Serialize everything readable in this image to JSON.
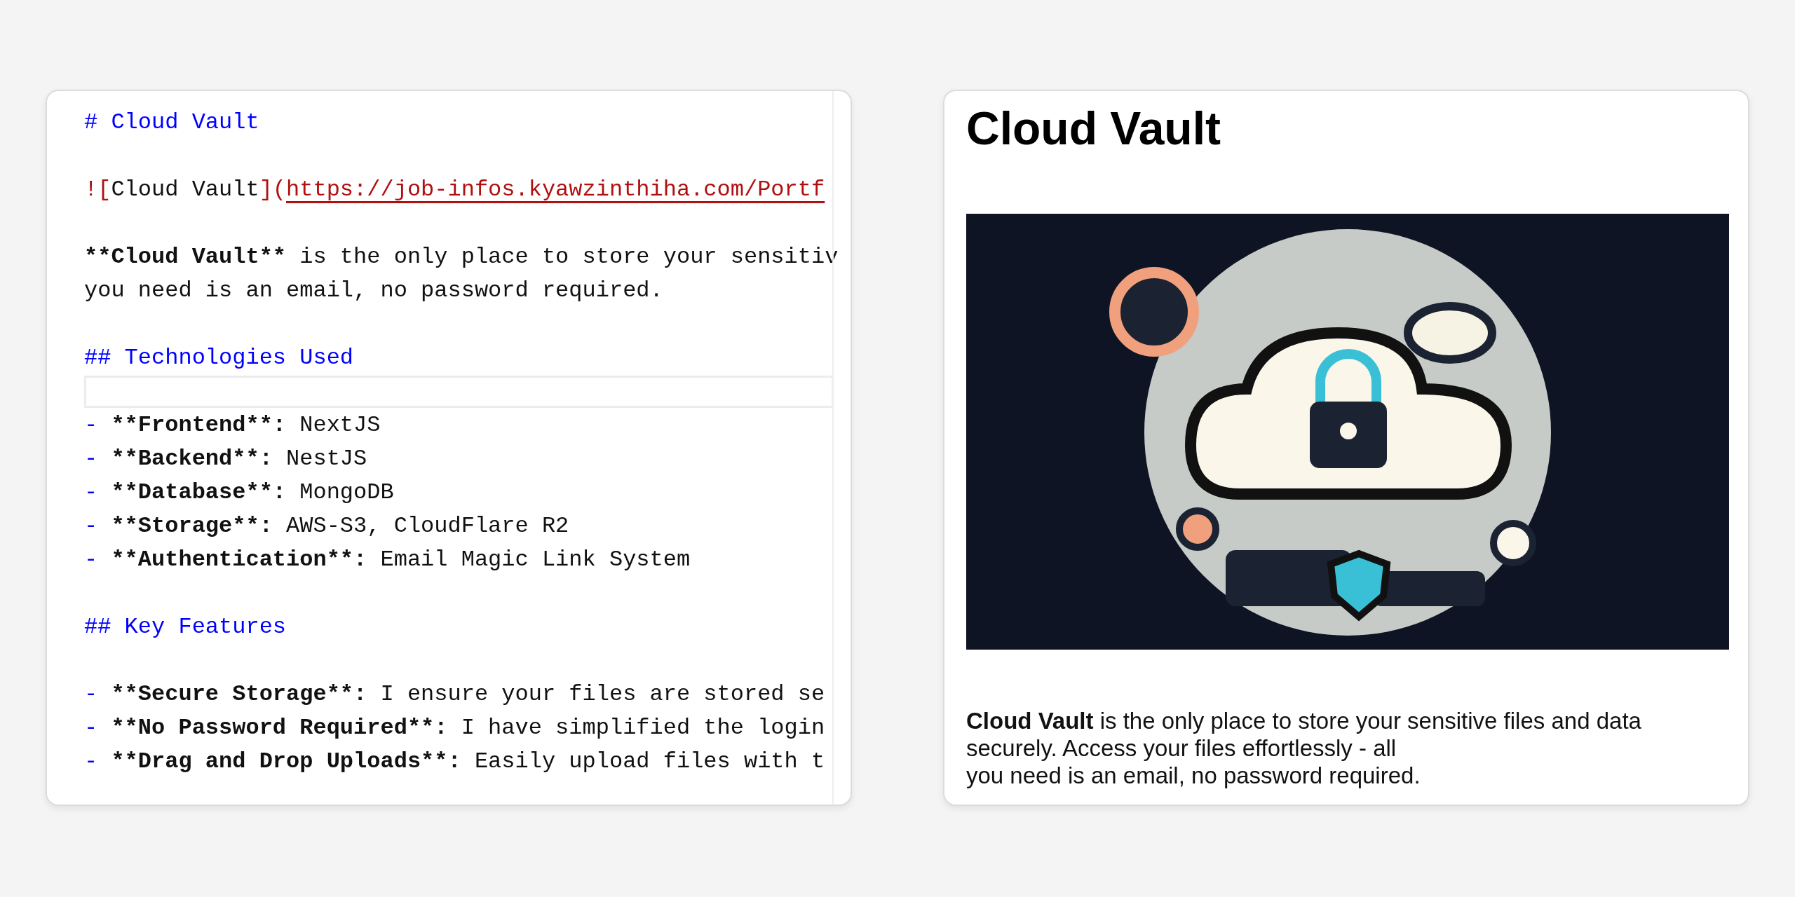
{
  "editor": {
    "lines": [
      {
        "kind": "heading",
        "parts": [
          {
            "kind": "heading",
            "text": "# Cloud Vault"
          }
        ]
      },
      {
        "kind": "blank"
      },
      {
        "kind": "text",
        "parts": [
          {
            "kind": "punct",
            "text": "!["
          },
          {
            "kind": "plain",
            "text": "Cloud Vault"
          },
          {
            "kind": "punct",
            "text": "]("
          },
          {
            "kind": "url",
            "text": "https://job-infos.kyawzinthiha.com/Portf"
          }
        ]
      },
      {
        "kind": "blank"
      },
      {
        "kind": "text",
        "parts": [
          {
            "kind": "bold",
            "text": "**Cloud Vault**"
          },
          {
            "kind": "plain",
            "text": " is the only place to store your sensitiv"
          }
        ]
      },
      {
        "kind": "text",
        "parts": [
          {
            "kind": "plain",
            "text": "you need is an email, no password required."
          }
        ]
      },
      {
        "kind": "blank"
      },
      {
        "kind": "heading",
        "parts": [
          {
            "kind": "heading",
            "text": "## Technologies Used"
          }
        ]
      },
      {
        "kind": "current"
      },
      {
        "kind": "text",
        "parts": [
          {
            "kind": "bullet",
            "text": "-"
          },
          {
            "kind": "bold",
            "text": " **Frontend**:"
          },
          {
            "kind": "plain",
            "text": " NextJS"
          }
        ]
      },
      {
        "kind": "text",
        "parts": [
          {
            "kind": "bullet",
            "text": "-"
          },
          {
            "kind": "bold",
            "text": " **Backend**:"
          },
          {
            "kind": "plain",
            "text": " NestJS"
          }
        ]
      },
      {
        "kind": "text",
        "parts": [
          {
            "kind": "bullet",
            "text": "-"
          },
          {
            "kind": "bold",
            "text": " **Database**:"
          },
          {
            "kind": "plain",
            "text": " MongoDB"
          }
        ]
      },
      {
        "kind": "text",
        "parts": [
          {
            "kind": "bullet",
            "text": "-"
          },
          {
            "kind": "bold",
            "text": " **Storage**:"
          },
          {
            "kind": "plain",
            "text": " AWS-S3, CloudFlare R2"
          }
        ]
      },
      {
        "kind": "text",
        "parts": [
          {
            "kind": "bullet",
            "text": "-"
          },
          {
            "kind": "bold",
            "text": " **Authentication**:"
          },
          {
            "kind": "plain",
            "text": " Email Magic Link System"
          }
        ]
      },
      {
        "kind": "blank"
      },
      {
        "kind": "heading",
        "parts": [
          {
            "kind": "heading",
            "text": "## Key Features"
          }
        ]
      },
      {
        "kind": "blank"
      },
      {
        "kind": "text",
        "parts": [
          {
            "kind": "bullet",
            "text": "-"
          },
          {
            "kind": "bold",
            "text": " **Secure Storage**:"
          },
          {
            "kind": "plain",
            "text": " I ensure your files are stored se"
          }
        ]
      },
      {
        "kind": "text",
        "parts": [
          {
            "kind": "bullet",
            "text": "-"
          },
          {
            "kind": "bold",
            "text": " **No Password Required**:"
          },
          {
            "kind": "plain",
            "text": " I have simplified the login"
          }
        ]
      },
      {
        "kind": "text",
        "parts": [
          {
            "kind": "bullet",
            "text": "-"
          },
          {
            "kind": "bold",
            "text": " **Drag and Drop Uploads**:"
          },
          {
            "kind": "plain",
            "text": " Easily upload files with t"
          }
        ]
      }
    ]
  },
  "preview": {
    "title": "Cloud Vault",
    "image": {
      "kind": "picture"
    },
    "paragraph_lines": [
      "**Cloud Vault** is the only place to store your sensitive files and data securely. Access your files effortlessly - all",
      "you need is an email, no password required."
    ]
  }
}
